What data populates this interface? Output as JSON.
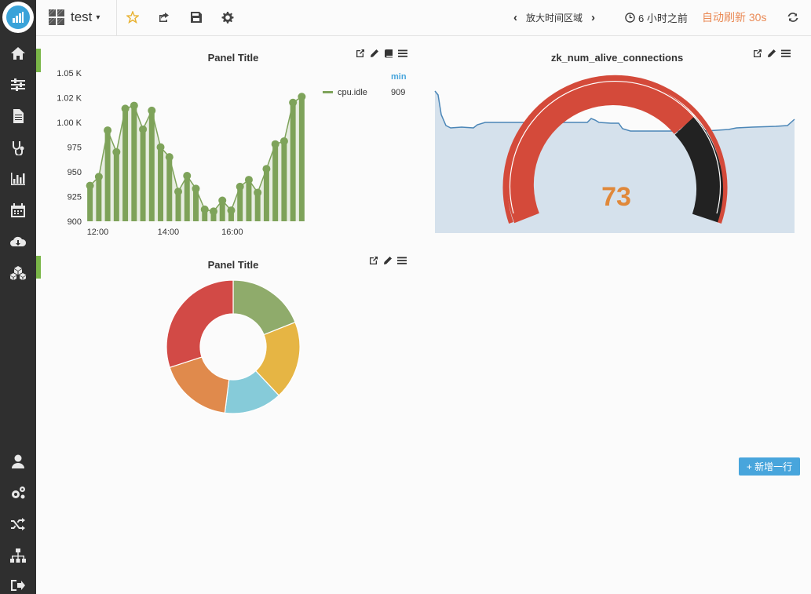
{
  "sidebar": {
    "items": [
      {
        "name": "home-icon"
      },
      {
        "name": "sliders-icon"
      },
      {
        "name": "document-icon"
      },
      {
        "name": "stethoscope-icon"
      },
      {
        "name": "bar-chart-icon"
      },
      {
        "name": "calendar-icon"
      },
      {
        "name": "cloud-download-icon"
      },
      {
        "name": "cubes-icon"
      },
      {
        "name": "user-icon"
      },
      {
        "name": "cogs-icon"
      },
      {
        "name": "shuffle-icon"
      },
      {
        "name": "sitemap-icon"
      },
      {
        "name": "sign-out-icon"
      }
    ]
  },
  "topbar": {
    "dashboard_title": "test",
    "zoom_out_label": "放大时间区域",
    "time_range_label": "6 小时之前",
    "refresh_label": "自动刷新 30s"
  },
  "panels": {
    "graph": {
      "title": "Panel Title",
      "legend_header": "min",
      "legend_series": "cpu.idle",
      "legend_value": "909"
    },
    "gauge": {
      "title": "zk_num_alive_connections",
      "value": "73"
    },
    "pie": {
      "title": "Panel Title"
    }
  },
  "add_row_label": "+ 新增一行",
  "colors": {
    "series_green": "#7ea35a",
    "gauge_red": "#d44a3a",
    "gauge_dark": "#222222",
    "gauge_value": "#e0883a",
    "accent_blue": "#48a5dc",
    "refresh_orange": "#ea8a56"
  },
  "chart_data": [
    {
      "type": "bar",
      "title": "Panel Title",
      "series": [
        {
          "name": "cpu.idle",
          "values": [
            936,
            945,
            992,
            970,
            1014,
            1017,
            993,
            1012,
            975,
            965,
            930,
            946,
            933,
            912,
            910,
            921,
            911,
            935,
            942,
            929,
            953,
            978,
            981,
            1020,
            1026
          ]
        }
      ],
      "x_tick_labels": [
        "12:00",
        "14:00",
        "16:00"
      ],
      "y_tick_labels": [
        "900",
        "925",
        "950",
        "975",
        "1.00 K",
        "1.02 K",
        "1.05 K"
      ],
      "ylim": [
        900,
        1050
      ],
      "grid": false
    },
    {
      "type": "pie",
      "title": "Panel Title",
      "slices": [
        {
          "value": 19,
          "color": "#8fab6b"
        },
        {
          "value": 19,
          "color": "#e6b544"
        },
        {
          "value": 14,
          "color": "#86cbd9"
        },
        {
          "value": 18,
          "color": "#e08a4c"
        },
        {
          "value": 30,
          "color": "#d24a46"
        }
      ]
    }
  ]
}
